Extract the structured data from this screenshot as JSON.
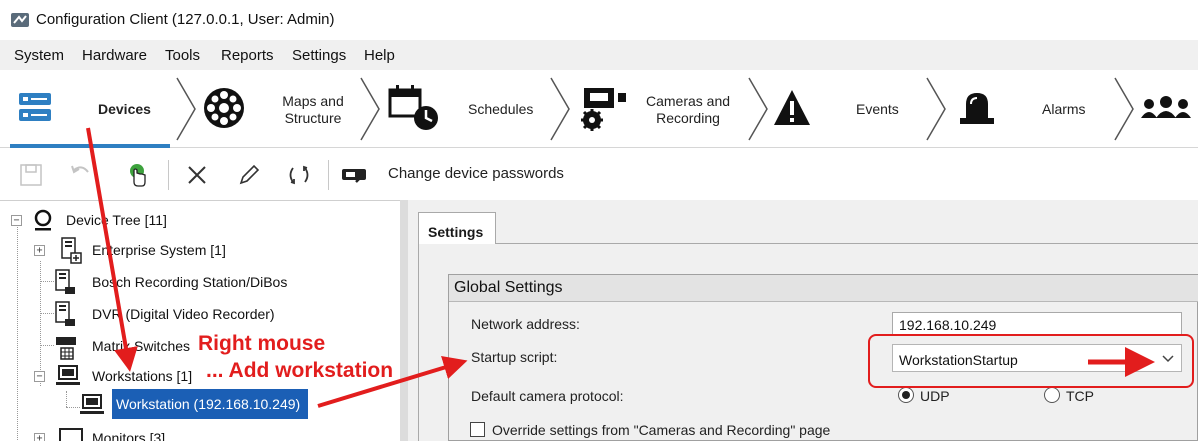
{
  "window": {
    "title": "Configuration Client (127.0.0.1, User: Admin)"
  },
  "menu": [
    "System",
    "Hardware",
    "Tools",
    "Reports",
    "Settings",
    "Help"
  ],
  "ribbon": {
    "tabs": [
      {
        "label": "Devices",
        "icon": "devices-icon"
      },
      {
        "label": "Maps and\nStructure",
        "icon": "maps-icon"
      },
      {
        "label": "Schedules",
        "icon": "schedules-icon"
      },
      {
        "label": "Cameras and\nRecording",
        "icon": "camera-icon"
      },
      {
        "label": "Events",
        "icon": "warning-icon"
      },
      {
        "label": "Alarms",
        "icon": "alarm-icon"
      },
      {
        "label": "",
        "icon": "users-icon"
      }
    ]
  },
  "toolbar": {
    "change_passwords_label": "Change device passwords",
    "icons": [
      "save-icon",
      "undo-icon",
      "hand-icon",
      "delete-icon",
      "edit-icon",
      "refresh-icon",
      "key-icon"
    ]
  },
  "tree": {
    "root": "Device Tree [11]",
    "items": [
      {
        "label": "Enterprise System [1]"
      },
      {
        "label": "Bosch Recording Station/DiBos"
      },
      {
        "label": "DVR (Digital Video Recorder)"
      },
      {
        "label": "Matrix Switches"
      },
      {
        "label": "Workstations [1]"
      },
      {
        "label": "Workstation (192.168.10.249)"
      },
      {
        "label": "Monitors [3]"
      }
    ]
  },
  "settings": {
    "tab_label": "Settings",
    "group_title": "Global Settings",
    "network_label": "Network address:",
    "network_value": "192.168.10.249",
    "startup_label": "Startup script:",
    "startup_value": "WorkstationStartup",
    "protocol_label": "Default camera protocol:",
    "protocol_options": [
      "UDP",
      "TCP"
    ],
    "protocol_selected": "UDP",
    "override_label": "Override settings from \"Cameras and Recording\" page"
  },
  "annotations": {
    "right_mouse": "Right mouse",
    "add_workstation": "... Add workstation"
  },
  "colors": {
    "annotation_red": "#e21d1d",
    "selection_blue": "#1b5fb5",
    "ribbon_accent": "#2e7fc2"
  }
}
